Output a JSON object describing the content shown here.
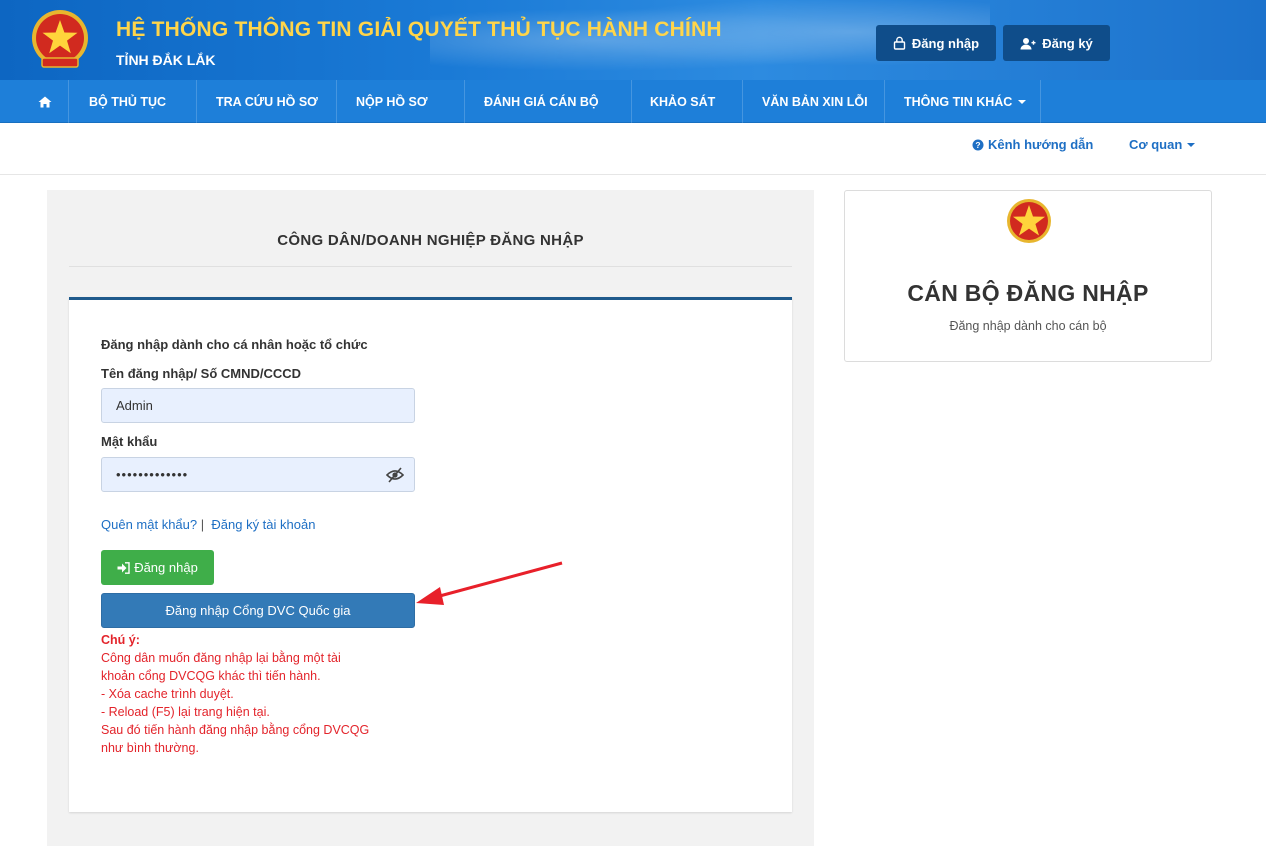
{
  "header": {
    "title": "HỆ THỐNG THÔNG TIN GIẢI QUYẾT THỦ TỤC HÀNH CHÍNH",
    "subtitle": "TỈNH ĐẮK LẮK",
    "login_label": "Đăng nhập",
    "register_label": "Đăng ký",
    "emblem_icon": "national-emblem"
  },
  "nav": {
    "home_icon": "home-icon",
    "items": [
      {
        "label": "BỘ THỦ TỤC"
      },
      {
        "label": "TRA CỨU HỒ SƠ"
      },
      {
        "label": "NỘP HỒ SƠ"
      },
      {
        "label": "ĐÁNH GIÁ CÁN BỘ"
      },
      {
        "label": "KHẢO SÁT"
      },
      {
        "label": "VĂN BẢN XIN LỖI"
      },
      {
        "label": "THÔNG TIN KHÁC"
      }
    ]
  },
  "subbar": {
    "guide_label": "Kênh hướng dẫn",
    "agency_label": "Cơ quan"
  },
  "login": {
    "panel_title": "CÔNG DÂN/DOANH NGHIỆP ĐĂNG NHẬP",
    "intro": "Đăng nhập dành cho cá nhân hoặc tổ chức",
    "username_label": "Tên đăng nhập/ Số CMND/CCCD",
    "username_value": "Admin",
    "password_label": "Mật khẩu",
    "password_value": "•••••••••••••",
    "forgot_label": "Quên mật khẩu?",
    "separator": "|",
    "register_label": "Đăng ký tài khoản",
    "login_button": "Đăng nhập",
    "dvc_button": "Đăng nhập Cổng DVC Quốc gia",
    "note_title": "Chú ý:",
    "note_lines": [
      "Công dân muốn đăng nhập lại bằng một tài",
      "khoản cổng DVCQG khác thì tiến hành.",
      "- Xóa cache trình duyệt.",
      "- Reload (F5) lại trang hiện tại.",
      "Sau đó tiến hành đăng nhập bằng cổng DVCQG",
      "như bình thường."
    ]
  },
  "staff": {
    "title": "CÁN BỘ ĐĂNG NHẬP",
    "subtitle": "Đăng nhập dành cho cán bộ"
  },
  "colors": {
    "header_blue": "#1a7ad6",
    "nav_blue": "#1e7fd9",
    "title_yellow": "#ffd54a",
    "green_button": "#3fae49",
    "dvc_button": "#337ab7",
    "note_red": "#e3242b",
    "annotation_arrow": "#e8202a"
  }
}
